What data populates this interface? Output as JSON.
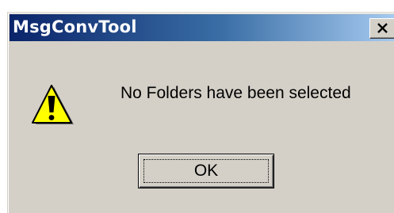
{
  "window": {
    "title": "MsgConvTool",
    "close_icon": "close-icon"
  },
  "content": {
    "icon": "warning-icon",
    "message": "No Folders have been selected"
  },
  "buttons": {
    "ok_label": "OK"
  },
  "colors": {
    "dialog_background": "#d4d0c8",
    "titlebar_start": "#0a246a",
    "titlebar_end": "#a6caf0",
    "warning_yellow": "#ffff00"
  }
}
